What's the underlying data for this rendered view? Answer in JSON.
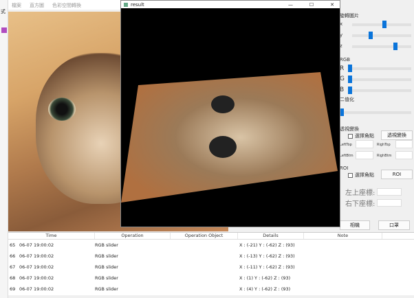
{
  "menu": [
    "檔案",
    "直方圖",
    "色彩空間轉換"
  ],
  "left_strip": {
    "label": "式"
  },
  "result_window": {
    "title": "result",
    "min": "—",
    "max": "☐",
    "close": "✕"
  },
  "panel": {
    "rotate": {
      "title": "旋轉圖片",
      "x": "x",
      "y": "y",
      "z": "z",
      "values": [
        0.55,
        0.3,
        0.75
      ]
    },
    "rgb": {
      "title": "RGB",
      "r": "R",
      "g": "G",
      "b": "B",
      "values": [
        0,
        0,
        0
      ]
    },
    "binarize": {
      "title": "二值化",
      "value": 0
    },
    "perspective": {
      "title": "透視變換",
      "checkbox": "選擇角點",
      "button": "透視變換",
      "lt": "LeftTop",
      "rt": "RighTop",
      "lb": "LeftBtm",
      "rb": "RighBtm"
    },
    "roi": {
      "title": "ROI",
      "checkbox": "選擇角點",
      "button": "ROI",
      "tl": "左上座標:",
      "br": "右下座標:"
    },
    "camera": "相機",
    "mask": "口罩"
  },
  "table": {
    "headers": [
      "Time",
      "Operation",
      "Operation Object",
      "Details",
      "Note"
    ],
    "rows": [
      {
        "n": "65",
        "time": "06-07 19:00:02",
        "op": "RGB slider",
        "obj": "",
        "details": "X : (-21) Y : (-62) Z : (93)",
        "note": ""
      },
      {
        "n": "66",
        "time": "06-07 19:00:02",
        "op": "RGB slider",
        "obj": "",
        "details": "X : (-13) Y : (-62) Z : (93)",
        "note": ""
      },
      {
        "n": "67",
        "time": "06-07 19:00:02",
        "op": "RGB slider",
        "obj": "",
        "details": "X : (-11) Y : (-62) Z : (93)",
        "note": ""
      },
      {
        "n": "68",
        "time": "06-07 19:00:02",
        "op": "RGB slider",
        "obj": "",
        "details": "X : (1) Y : (-62) Z : (93)",
        "note": ""
      },
      {
        "n": "69",
        "time": "06-07 19:00:02",
        "op": "RGB slider",
        "obj": "",
        "details": "X : (4) Y : (-62) Z : (93)",
        "note": ""
      }
    ]
  }
}
